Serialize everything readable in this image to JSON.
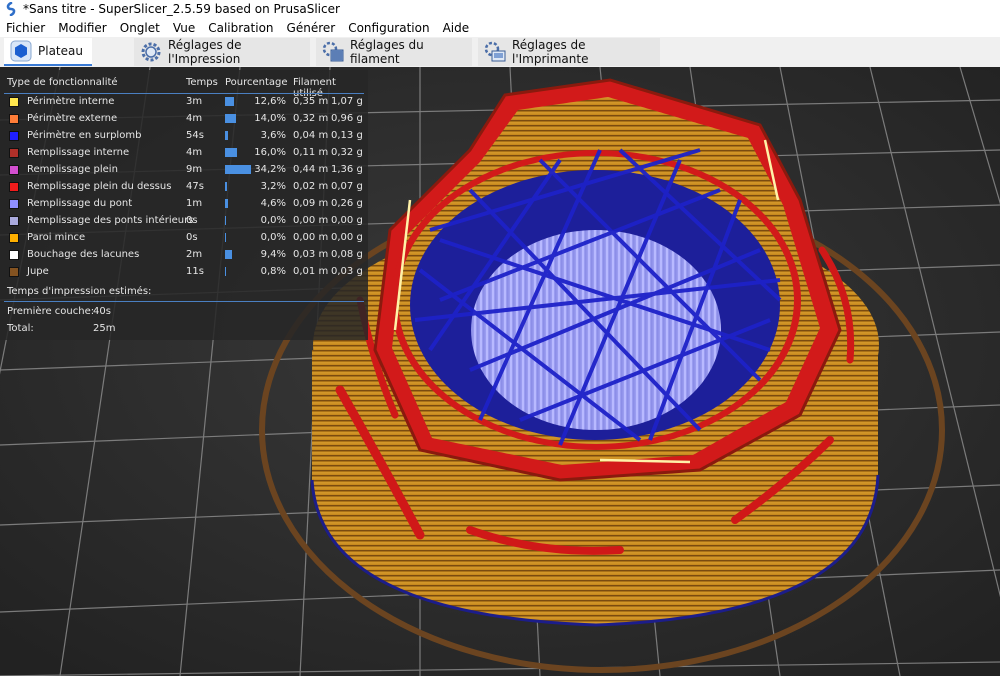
{
  "window": {
    "title": "*Sans titre - SuperSlicer_2.5.59  based on PrusaSlicer"
  },
  "menu": [
    "Fichier",
    "Modifier",
    "Onglet",
    "Vue",
    "Calibration",
    "Générer",
    "Configuration",
    "Aide"
  ],
  "tabs": [
    {
      "label": "Plateau",
      "active": true
    },
    {
      "label": "Réglages de l'Impression",
      "active": false
    },
    {
      "label": "Réglages du filament",
      "active": false
    },
    {
      "label": "Réglages de l'Imprimante",
      "active": false
    }
  ],
  "legend": {
    "headers": {
      "type": "Type de fonctionnalité",
      "time": "Temps",
      "percent": "Pourcentage",
      "filament": "Filament utilisé"
    },
    "rows": [
      {
        "name": "Périmètre interne",
        "time": "3m",
        "share": 0.126,
        "percent": "12,6%",
        "length": "0,35 m",
        "weight": "1,07 g",
        "color": "#ffe64d"
      },
      {
        "name": "Périmètre externe",
        "time": "4m",
        "share": 0.14,
        "percent": "14,0%",
        "length": "0,32 m",
        "weight": "0,96 g",
        "color": "#ff7d38"
      },
      {
        "name": "Périmètre en surplomb",
        "time": "54s",
        "share": 0.036,
        "percent": "3,6%",
        "length": "0,04 m",
        "weight": "0,13 g",
        "color": "#1f1fff"
      },
      {
        "name": "Remplissage interne",
        "time": "4m",
        "share": 0.16,
        "percent": "16,0%",
        "length": "0,11 m",
        "weight": "0,32 g",
        "color": "#b03029"
      },
      {
        "name": "Remplissage plein",
        "time": "9m",
        "share": 0.342,
        "percent": "34,2%",
        "length": "0,44 m",
        "weight": "1,36 g",
        "color": "#d34fd0"
      },
      {
        "name": "Remplissage plein du dessus",
        "time": "47s",
        "share": 0.032,
        "percent": "3,2%",
        "length": "0,02 m",
        "weight": "0,07 g",
        "color": "#f01c1c"
      },
      {
        "name": "Remplissage du pont",
        "time": "1m",
        "share": 0.046,
        "percent": "4,6%",
        "length": "0,09 m",
        "weight": "0,26 g",
        "color": "#8f8fff"
      },
      {
        "name": "Remplissage des ponts intérieurs",
        "time": "0s",
        "share": 0.0,
        "percent": "0,0%",
        "length": "0,00 m",
        "weight": "0,00 g",
        "color": "#aaaadd"
      },
      {
        "name": "Paroi mince",
        "time": "0s",
        "share": 0.0,
        "percent": "0,0%",
        "length": "0,00 m",
        "weight": "0,00 g",
        "color": "#ffb000"
      },
      {
        "name": "Bouchage des lacunes",
        "time": "2m",
        "share": 0.094,
        "percent": "9,4%",
        "length": "0,03 m",
        "weight": "0,08 g",
        "color": "#ffffff"
      },
      {
        "name": "Jupe",
        "time": "11s",
        "share": 0.008,
        "percent": "0,8%",
        "length": "0,01 m",
        "weight": "0,03 g",
        "color": "#845321"
      }
    ],
    "estimates": {
      "title": "Temps d'impression estimés:",
      "first_layer_label": "Première couche:",
      "first_layer_value": "40s",
      "total_label": "Total:",
      "total_value": "25m"
    }
  }
}
